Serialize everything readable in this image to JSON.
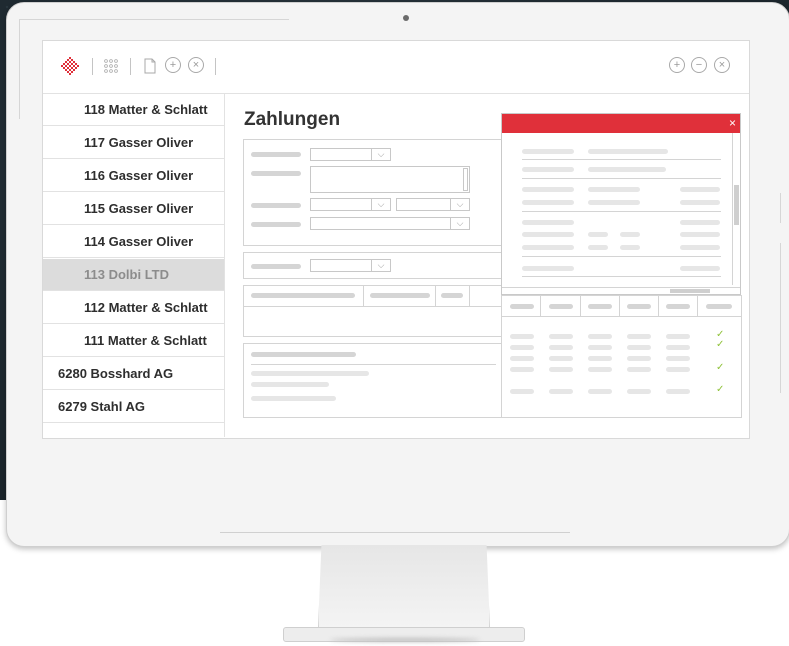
{
  "sidebar": {
    "items": [
      {
        "label": "118 Matter & Schlatt",
        "selected": false,
        "indent": true
      },
      {
        "label": "117 Gasser Oliver",
        "selected": false,
        "indent": true
      },
      {
        "label": "116 Gasser Oliver",
        "selected": false,
        "indent": true
      },
      {
        "label": "115 Gasser Oliver",
        "selected": false,
        "indent": true
      },
      {
        "label": "114 Gasser Oliver",
        "selected": false,
        "indent": true
      },
      {
        "label": "113 Dolbi LTD",
        "selected": true,
        "indent": true
      },
      {
        "label": "112 Matter & Schlatt",
        "selected": false,
        "indent": true
      },
      {
        "label": "111 Matter & Schlatt",
        "selected": false,
        "indent": true
      },
      {
        "label": "6280 Bosshard AG",
        "selected": false,
        "indent": false
      },
      {
        "label": "6279 Stahl AG",
        "selected": false,
        "indent": false
      }
    ]
  },
  "main": {
    "title": "Zahlungen"
  },
  "modal": {
    "close_glyph": "×"
  },
  "toolbar": {
    "left_icons": [
      "logo-icon",
      "grid-icon",
      "document-icon",
      "add-icon",
      "close-icon"
    ],
    "right_icons": [
      "add-icon",
      "minus-icon",
      "close-icon"
    ],
    "plus_glyph": "+",
    "minus_glyph": "−",
    "times_glyph": "×"
  },
  "colors": {
    "accent": "#e0303a",
    "check": "#8fc23a",
    "selected_row": "#dcdcdc"
  }
}
